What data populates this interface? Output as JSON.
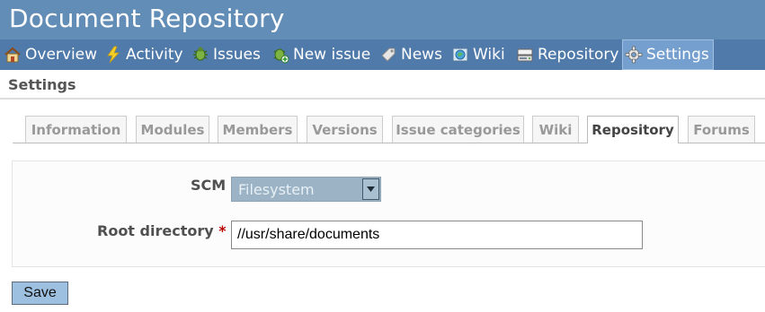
{
  "header": {
    "project_title": "Document Repository"
  },
  "main_menu": {
    "items": [
      {
        "label": "Overview",
        "icon": "home-icon"
      },
      {
        "label": "Activity",
        "icon": "lightning-icon"
      },
      {
        "label": "Issues",
        "icon": "bug-icon"
      },
      {
        "label": "New issue",
        "icon": "bug-add-icon"
      },
      {
        "label": "News",
        "icon": "news-tag-icon"
      },
      {
        "label": "Wiki",
        "icon": "wiki-globe-icon"
      },
      {
        "label": "Repository",
        "icon": "repository-drive-icon"
      },
      {
        "label": "Settings",
        "icon": "gear-icon",
        "selected": true
      }
    ]
  },
  "page": {
    "heading": "Settings"
  },
  "tabs": [
    {
      "label": "Information"
    },
    {
      "label": "Modules"
    },
    {
      "label": "Members"
    },
    {
      "label": "Versions"
    },
    {
      "label": "Issue categories"
    },
    {
      "label": "Wiki"
    },
    {
      "label": "Repository",
      "selected": true
    },
    {
      "label": "Forums"
    }
  ],
  "form": {
    "scm_label": "SCM",
    "scm_value": "Filesystem",
    "root_directory_label": "Root directory",
    "required_marker": "*",
    "root_directory_value": "//usr/share/documents",
    "save_label": "Save"
  },
  "colors": {
    "header_bg": "#628db6",
    "menu_bg": "#507aaa",
    "menu_selected_bg": "#759fcf",
    "required": "#bb0000",
    "save_button_bg": "#9dbfe0"
  }
}
